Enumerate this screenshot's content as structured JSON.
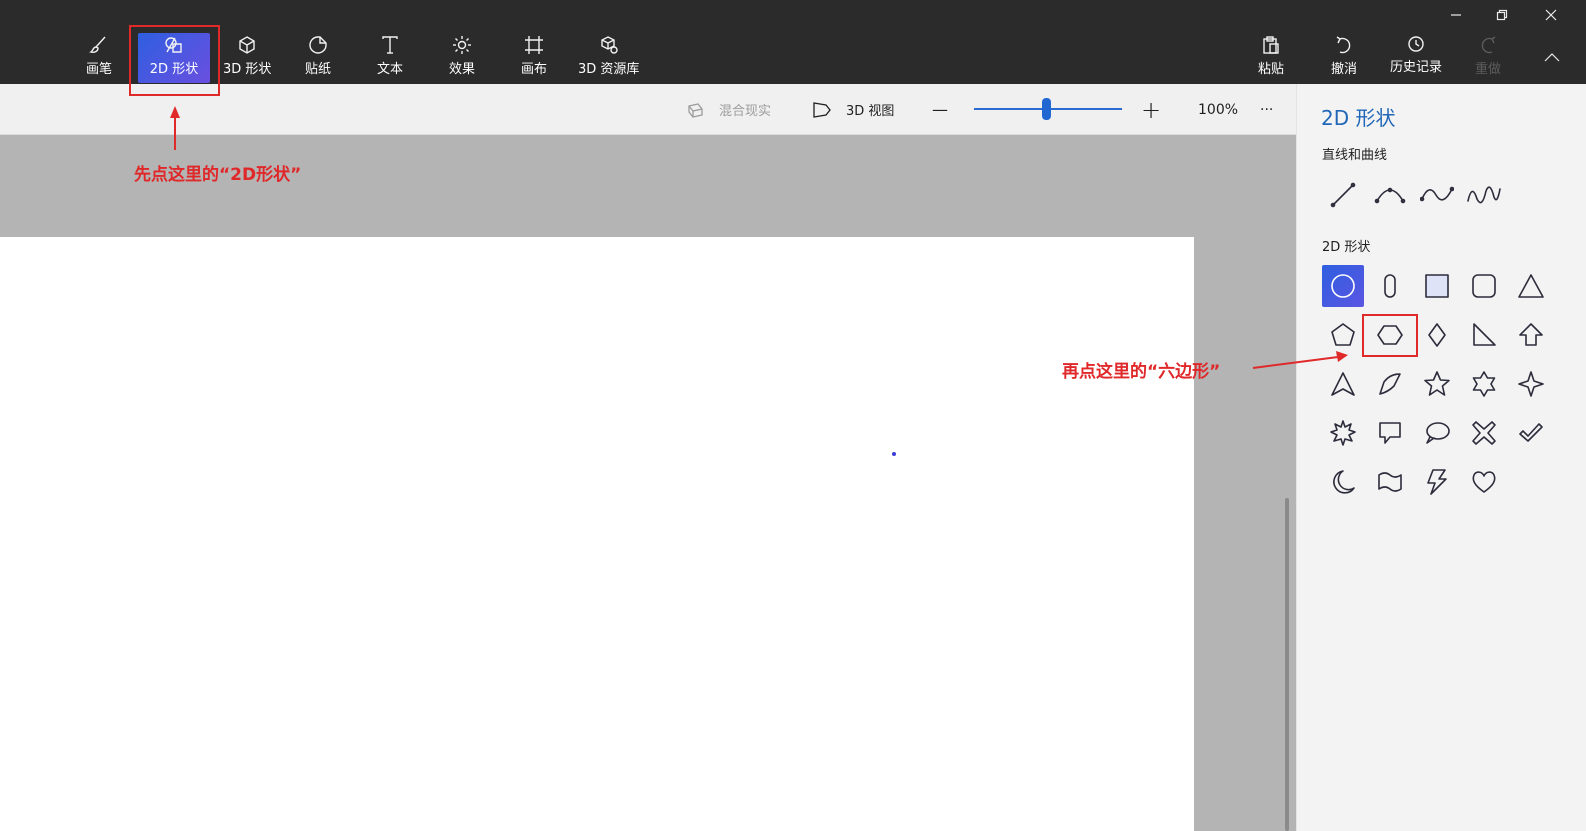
{
  "window_controls": {
    "minimize_icon": "minimize-icon",
    "restore_icon": "restore-icon",
    "close_icon": "close-icon"
  },
  "toolbar": {
    "tools": [
      {
        "label": "画笔",
        "icon": "brush-icon"
      },
      {
        "label": "2D 形状",
        "icon": "shapes-2d-icon"
      },
      {
        "label": "3D 形状",
        "icon": "cube-icon"
      },
      {
        "label": "贴纸",
        "icon": "sticker-icon"
      },
      {
        "label": "文本",
        "icon": "text-icon"
      },
      {
        "label": "效果",
        "icon": "sun-icon"
      },
      {
        "label": "画布",
        "icon": "crop-icon"
      },
      {
        "label": "3D 资源库",
        "icon": "library-icon"
      }
    ],
    "active_tool": "2D 形状",
    "right_tools": [
      {
        "label": "粘贴",
        "icon": "paste-icon"
      },
      {
        "label": "撤消",
        "icon": "undo-icon"
      },
      {
        "label": "历史记录",
        "icon": "history-icon"
      },
      {
        "label": "重做",
        "icon": "redo-icon"
      }
    ],
    "collapse_icon": "chevron-up-icon"
  },
  "subbar": {
    "mixed_reality": "混合现实",
    "view_3d": "3D 视图",
    "zoom_minus": "—",
    "zoom_plus": "+",
    "zoom_percent": "100%",
    "zoom_level": 0.5,
    "more": "···"
  },
  "annotations": {
    "first": "先点这里的“2D形状”",
    "second": "再点这里的“六边形”"
  },
  "panel": {
    "title": "2D 形状",
    "lines_label": "直线和曲线",
    "shapes_label": "2D 形状",
    "lines": [
      "line-icon",
      "curve-icon",
      "two-point-curve-icon",
      "three-point-curve-icon"
    ],
    "shapes": [
      "circle-icon",
      "capsule-icon",
      "square-icon",
      "rounded-square-icon",
      "triangle-icon",
      "pentagon-icon",
      "hexagon-icon",
      "diamond-icon",
      "right-triangle-icon",
      "arrow-up-icon",
      "arrowhead-icon",
      "quarter-circle-icon",
      "star-five-icon",
      "star-six-icon",
      "star-four-icon",
      "burst-icon",
      "speech-bubble-icon",
      "thought-bubble-icon",
      "x-mark-icon",
      "check-mark-icon",
      "moon-icon",
      "banner-icon",
      "lightning-icon",
      "heart-icon"
    ],
    "selected_shape": "circle-icon",
    "highlighted_shape": "hexagon-icon"
  },
  "colors": {
    "accent": "#2167d2",
    "annotation": "#e0282a",
    "titlebar": "#2b2b2b"
  }
}
